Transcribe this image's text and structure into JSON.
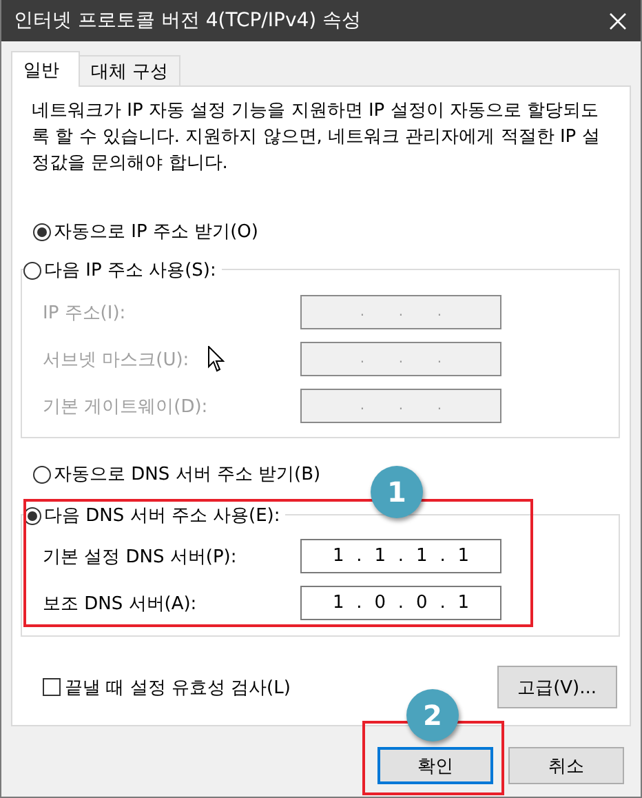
{
  "window": {
    "title": "인터넷 프로토콜 버전 4(TCP/IPv4) 속성"
  },
  "tabs": [
    {
      "label": "일반",
      "selected": true
    },
    {
      "label": "대체 구성",
      "selected": false
    }
  ],
  "description": "네트워크가 IP 자동 설정 기능을 지원하면 IP 설정이 자동으로 할당되도록 할 수 있습니다. 지원하지 않으면, 네트워크 관리자에게 적절한 IP 설정값을 문의해야 합니다.",
  "ip_options": [
    {
      "label": "자동으로 IP 주소 받기(O)",
      "selected": true
    },
    {
      "label": "다음 IP 주소 사용(S):",
      "selected": false
    }
  ],
  "ip_fields": [
    {
      "label": "IP 주소(I):",
      "disabled": true,
      "parts": [
        ".",
        ".",
        "."
      ]
    },
    {
      "label": "서브넷 마스크(U):",
      "disabled": true,
      "parts": [
        ".",
        ".",
        "."
      ]
    },
    {
      "label": "기본 게이트웨이(D):",
      "disabled": true,
      "parts": [
        ".",
        ".",
        "."
      ]
    }
  ],
  "dns_options": [
    {
      "label": "자동으로 DNS 서버 주소 받기(B)",
      "selected": false
    },
    {
      "label": "다음 DNS 서버 주소 사용(E):",
      "selected": true
    }
  ],
  "dns_fields": [
    {
      "label": "기본 설정 DNS 서버(P):",
      "disabled": false,
      "parts": [
        "1",
        ".",
        "1",
        ".",
        "1",
        ".",
        "1"
      ]
    },
    {
      "label": "보조 DNS 서버(A):",
      "disabled": false,
      "parts": [
        "1",
        ".",
        "0",
        ".",
        "0",
        ".",
        "1"
      ]
    }
  ],
  "validate": {
    "label": "끝낼 때 설정 유효성 검사(L)",
    "checked": false
  },
  "advanced_button": {
    "label": "고급(V)..."
  },
  "buttons": [
    {
      "label": "확인",
      "focused": true
    },
    {
      "label": "취소",
      "focused": false
    }
  ],
  "annotations": [
    {
      "number": "1"
    },
    {
      "number": "2"
    }
  ]
}
